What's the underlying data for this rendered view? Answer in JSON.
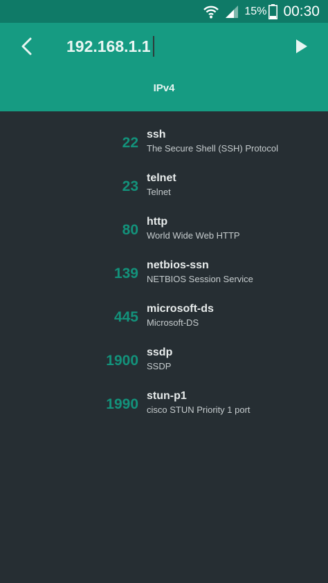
{
  "status_bar": {
    "battery_percent": "15%",
    "time": "00:30",
    "icons": [
      "wifi-icon",
      "signal-icon",
      "battery-icon"
    ]
  },
  "toolbar": {
    "back_icon": "chevron-left-icon",
    "host_value": "192.168.1.1",
    "go_icon": "play-icon",
    "tab_label": "IPv4"
  },
  "colors": {
    "status_bar": "#0f7a67",
    "app_bar": "#169b82",
    "background": "#262e33",
    "port_number": "#13927b"
  },
  "ports": [
    {
      "port": "22",
      "name": "ssh",
      "description": "The Secure Shell (SSH) Protocol"
    },
    {
      "port": "23",
      "name": "telnet",
      "description": "Telnet"
    },
    {
      "port": "80",
      "name": "http",
      "description": "World Wide Web HTTP"
    },
    {
      "port": "139",
      "name": "netbios-ssn",
      "description": "NETBIOS Session Service"
    },
    {
      "port": "445",
      "name": "microsoft-ds",
      "description": "Microsoft-DS"
    },
    {
      "port": "1900",
      "name": "ssdp",
      "description": "SSDP"
    },
    {
      "port": "1990",
      "name": "stun-p1",
      "description": "cisco STUN Priority 1 port"
    }
  ]
}
